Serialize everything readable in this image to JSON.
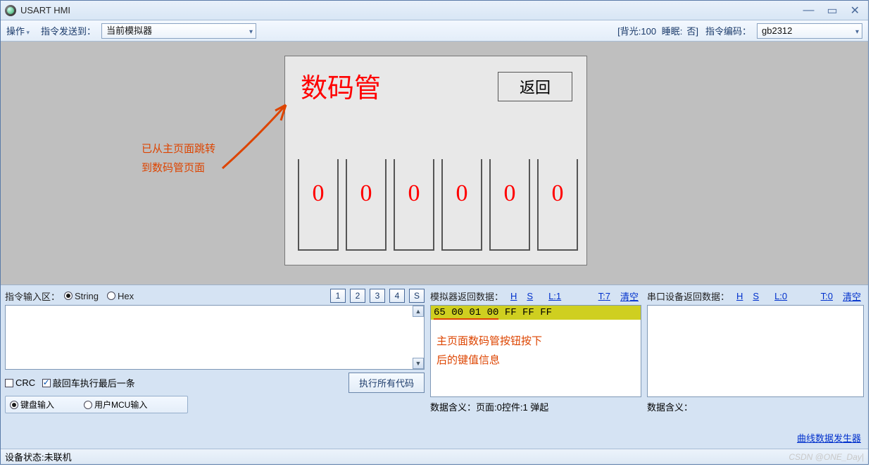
{
  "app": {
    "title": "USART HMI"
  },
  "winbtns": {
    "min": "—",
    "max": "▭",
    "close": "✕"
  },
  "toolbar": {
    "operate": "操作",
    "send_to_label": "指令发送到：",
    "send_to_value": "当前模拟器",
    "backlight_label": "[背光:",
    "backlight_value": "100",
    "sleep_label": "睡眠:",
    "sleep_value": "否]",
    "encode_label": "指令编码：",
    "encode_value": "gb2312"
  },
  "sim": {
    "title": "数码管",
    "back_btn": "返回",
    "digits": [
      "0",
      "0",
      "0",
      "0",
      "0",
      "0"
    ]
  },
  "annotation1": {
    "line1": "已从主页面跳转",
    "line2": "到数码管页面"
  },
  "input_area": {
    "label": "指令输入区：",
    "radio_string": "String",
    "radio_hex": "Hex",
    "nums": [
      "1",
      "2",
      "3",
      "4"
    ],
    "s_btn": "S",
    "crc_label": "CRC",
    "enter_last_label": "敲回车执行最后一条",
    "execute_all": "执行所有代码",
    "mode_kbd": "键盘输入",
    "mode_mcu": "用户MCU输入"
  },
  "sim_return": {
    "label": "模拟器返回数据：",
    "h": "H",
    "s": "S",
    "l_label": "L:",
    "l_val": "1",
    "t_label": "T:",
    "t_val": "7",
    "clear": "清空",
    "row0_u": "65 00 01 00",
    "row0_rest": " FF FF FF",
    "meaning_label": "数据含义：",
    "meaning_value": "页面:0控件:1 弹起"
  },
  "serial_return": {
    "label": "串口设备返回数据：",
    "h": "H",
    "s": "S",
    "l_label": "L:",
    "l_val": "0",
    "t_label": "T:",
    "t_val": "0",
    "clear": "清空",
    "meaning_label": "数据含义："
  },
  "annotation2": {
    "line1": "主页面数码管按钮按下",
    "line2": "后的键值信息"
  },
  "curve_gen": "曲线数据发生器",
  "statusbar": {
    "label": "设备状态:",
    "value": "未联机"
  },
  "watermark": "CSDN @ONE_Day|"
}
